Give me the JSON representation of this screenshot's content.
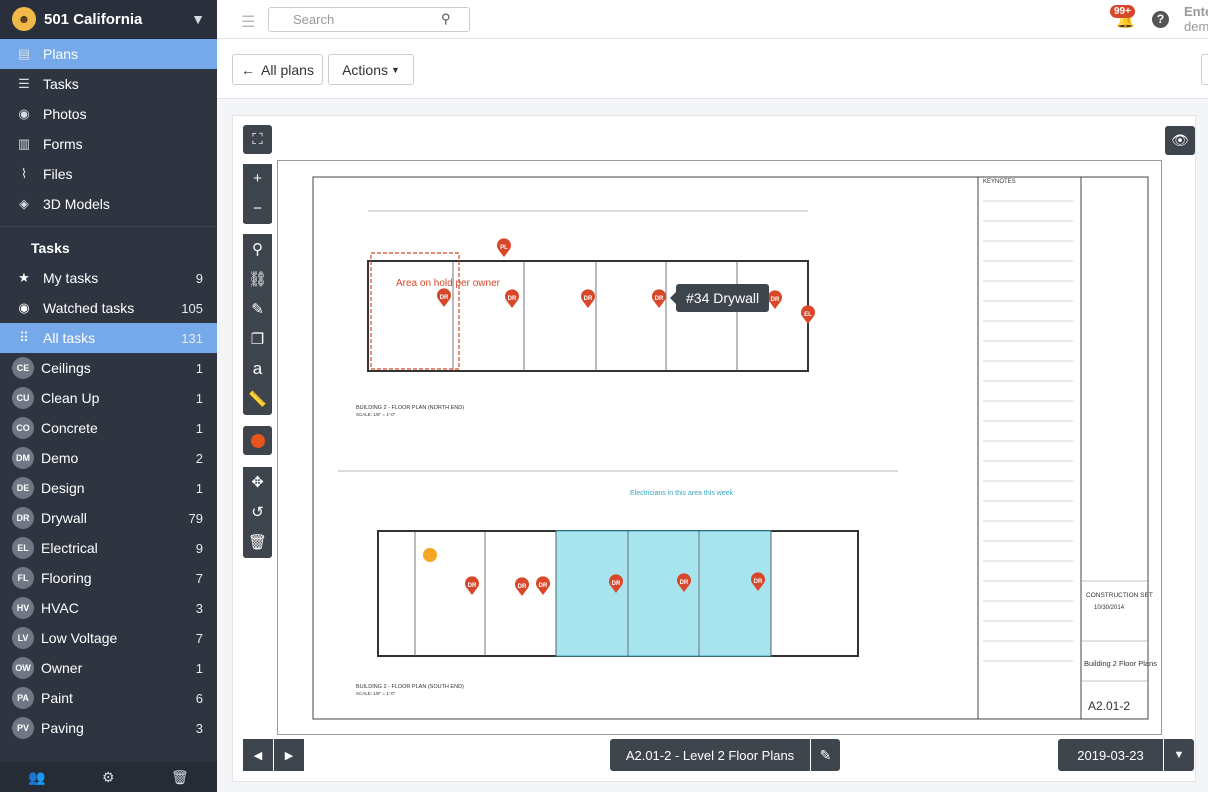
{
  "project": {
    "name": "501 California",
    "logo": "☻"
  },
  "nav": [
    {
      "label": "Plans",
      "icon": "map-icon",
      "glyph": "▤",
      "active": true
    },
    {
      "label": "Tasks",
      "icon": "list-icon",
      "glyph": "☰",
      "active": false
    },
    {
      "label": "Photos",
      "icon": "camera-icon",
      "glyph": "◉",
      "active": false
    },
    {
      "label": "Forms",
      "icon": "clipboard-icon",
      "glyph": "▥",
      "active": false
    },
    {
      "label": "Files",
      "icon": "paperclip-icon",
      "glyph": "⌇",
      "active": false
    },
    {
      "label": "3D Models",
      "icon": "cube-icon",
      "glyph": "◈",
      "active": false
    }
  ],
  "tasks_section": {
    "title": "Tasks",
    "filters": [
      {
        "label": "My tasks",
        "count": "9",
        "glyph": "★",
        "icon": "star-icon"
      },
      {
        "label": "Watched tasks",
        "count": "105",
        "glyph": "◉",
        "icon": "eye-icon"
      },
      {
        "label": "All tasks",
        "count": "131",
        "glyph": "⠿",
        "icon": "grid-icon",
        "active": true
      }
    ],
    "categories": [
      {
        "abbr": "CE",
        "label": "Ceilings",
        "count": "1"
      },
      {
        "abbr": "CU",
        "label": "Clean Up",
        "count": "1"
      },
      {
        "abbr": "CO",
        "label": "Concrete",
        "count": "1"
      },
      {
        "abbr": "DM",
        "label": "Demo",
        "count": "2"
      },
      {
        "abbr": "DE",
        "label": "Design",
        "count": "1"
      },
      {
        "abbr": "DR",
        "label": "Drywall",
        "count": "79"
      },
      {
        "abbr": "EL",
        "label": "Electrical",
        "count": "9"
      },
      {
        "abbr": "FL",
        "label": "Flooring",
        "count": "7"
      },
      {
        "abbr": "HV",
        "label": "HVAC",
        "count": "3"
      },
      {
        "abbr": "LV",
        "label": "Low Voltage",
        "count": "7"
      },
      {
        "abbr": "OW",
        "label": "Owner",
        "count": "1"
      },
      {
        "abbr": "PA",
        "label": "Paint",
        "count": "6"
      },
      {
        "abbr": "PV",
        "label": "Paving",
        "count": "3"
      }
    ]
  },
  "topbar": {
    "search_placeholder": "Search",
    "notifications": "99+",
    "help": "?",
    "user_name": "Ente",
    "user_email": "dem"
  },
  "toolbar": {
    "all_plans": "All plans",
    "actions": "Actions"
  },
  "viewer": {
    "sheet_label": "A2.01-2 - Level 2 Floor Plans",
    "date": "2019-03-23",
    "tooltip": "#34 Drywall"
  },
  "drawing": {
    "keynotes_title": "KEYNOTES",
    "plan_north": "BUILDING 2 - FLOOR PLAN (NORTH END)",
    "plan_south": "BUILDING 2 - FLOOR PLAN (SOUTH END)",
    "scale": "SCALE: 1/8\" = 1'-0\"",
    "area_note": "Area on hold per owner",
    "electric_note": "Electricians in this area this week",
    "set_title": "CONSTRUCTION SET",
    "set_date": "10/30/2014",
    "sheet_name": "Building 2 Floor Plans",
    "sheet_number": "A2.01-2",
    "pin_labels": [
      "PL",
      "DR",
      "DR",
      "DR",
      "DR",
      "DR",
      "EL",
      "DR",
      "DR",
      "DR",
      "DR",
      "DR",
      "DR"
    ]
  },
  "colors": {
    "sidebar": "#2e3541",
    "accent": "#75a9ea",
    "pin": "#d9472b",
    "highlight": "#a8e4ee"
  }
}
